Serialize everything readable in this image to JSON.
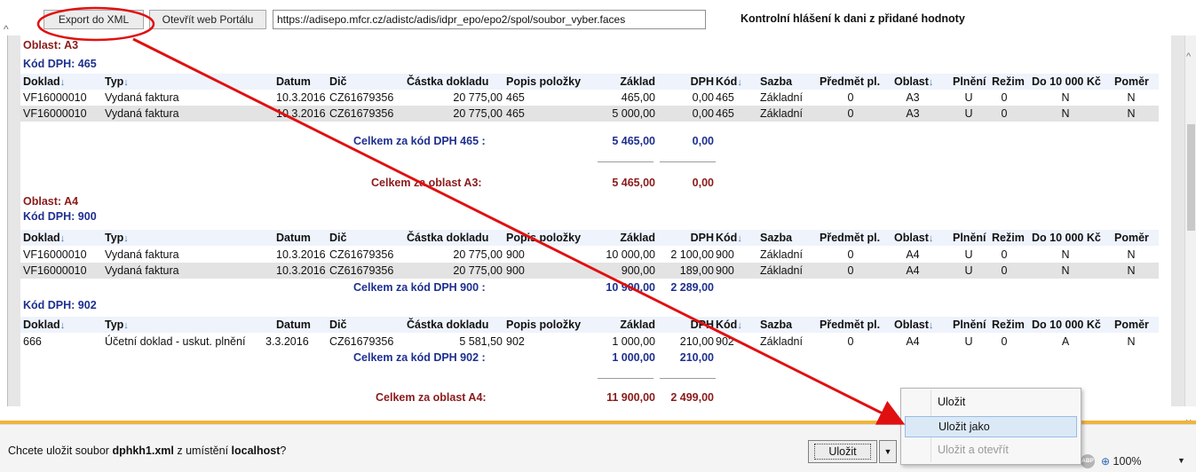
{
  "toolbar": {
    "export_label": "Export do XML",
    "portal_label": "Otevřít web Portálu",
    "url_value": "https://adisepo.mfcr.cz/adistc/adis/idpr_epo/epo2/spol/soubor_vyber.faces",
    "title": "Kontrolní hlášení k dani z přidané hodnoty"
  },
  "columns": {
    "doklad": "Doklad",
    "typ": "Typ",
    "datum": "Datum",
    "dic": "Dič",
    "castka": "Částka dokladu",
    "popis": "Popis položky",
    "zaklad": "Základ",
    "dph": "DPH",
    "kod": "Kód",
    "sazba": "Sazba",
    "predmet": "Předmět pl.",
    "oblast": "Oblast",
    "plneni": "Plnění",
    "rezim": "Režim",
    "do10000": "Do 10 000 Kč",
    "pomer": "Poměr"
  },
  "report": {
    "a3": {
      "title": "Oblast: A3",
      "code_title": "Kód DPH: 465",
      "rows": [
        {
          "doklad": "VF16000010",
          "typ": "Vydaná faktura",
          "datum": "10.3.2016",
          "dic": "CZ61679356",
          "castka": "20 775,00",
          "popis": "465",
          "zaklad": "465,00",
          "dph": "0,00",
          "kod": "465",
          "sazba": "Základní",
          "predmet": "0",
          "oblast": "A3",
          "plneni": "U",
          "rezim": "0",
          "do10000": "N",
          "pomer": "N"
        },
        {
          "doklad": "VF16000010",
          "typ": "Vydaná faktura",
          "datum": "10.3.2016",
          "dic": "CZ61679356",
          "castka": "20 775,00",
          "popis": "465",
          "zaklad": "5 000,00",
          "dph": "0,00",
          "kod": "465",
          "sazba": "Základní",
          "predmet": "0",
          "oblast": "A3",
          "plneni": "U",
          "rezim": "0",
          "do10000": "N",
          "pomer": "N"
        }
      ],
      "code_sum_label": "Celkem za kód DPH 465 :",
      "code_sum_zaklad": "5 465,00",
      "code_sum_dph": "0,00",
      "area_sum_label": "Celkem za oblast A3:",
      "area_sum_zaklad": "5 465,00",
      "area_sum_dph": "0,00"
    },
    "a4": {
      "title": "Oblast: A4",
      "code900_title": "Kód DPH: 900",
      "rows900": [
        {
          "doklad": "VF16000010",
          "typ": "Vydaná faktura",
          "datum": "10.3.2016",
          "dic": "CZ61679356",
          "castka": "20 775,00",
          "popis": "900",
          "zaklad": "10 000,00",
          "dph": "2 100,00",
          "kod": "900",
          "sazba": "Základní",
          "predmet": "0",
          "oblast": "A4",
          "plneni": "U",
          "rezim": "0",
          "do10000": "N",
          "pomer": "N"
        },
        {
          "doklad": "VF16000010",
          "typ": "Vydaná faktura",
          "datum": "10.3.2016",
          "dic": "CZ61679356",
          "castka": "20 775,00",
          "popis": "900",
          "zaklad": "900,00",
          "dph": "189,00",
          "kod": "900",
          "sazba": "Základní",
          "predmet": "0",
          "oblast": "A4",
          "plneni": "U",
          "rezim": "0",
          "do10000": "N",
          "pomer": "N"
        }
      ],
      "code900_sum_label": "Celkem za kód DPH 900 :",
      "code900_sum_zaklad": "10 900,00",
      "code900_sum_dph": "2 289,00",
      "code902_title": "Kód DPH: 902",
      "rows902": [
        {
          "doklad": "666",
          "typ": "Účetní doklad - uskut. plnění",
          "datum": "3.3.2016",
          "dic": "CZ61679356",
          "castka": "5 581,50",
          "popis": "902",
          "zaklad": "1 000,00",
          "dph": "210,00",
          "kod": "902",
          "sazba": "Základní",
          "predmet": "0",
          "oblast": "A4",
          "plneni": "U",
          "rezim": "0",
          "do10000": "A",
          "pomer": "N"
        }
      ],
      "code902_sum_label": "Celkem za kód DPH 902 :",
      "code902_sum_zaklad": "1 000,00",
      "code902_sum_dph": "210,00",
      "area_sum_label": "Celkem za oblast A4:",
      "area_sum_zaklad": "11 900,00",
      "area_sum_dph": "2 499,00"
    }
  },
  "notification": {
    "prefix": "Chcete uložit soubor ",
    "filename": "dphkh1.xml",
    "middle": " z umístění ",
    "location": "localhost",
    "suffix": "?",
    "save_label": "Uložit",
    "zoom": "100%",
    "abp_label": "ABP"
  },
  "menu": {
    "items": [
      "Uložit",
      "Uložit jako",
      "Uložit a otevřít"
    ]
  },
  "colors": {
    "area_title": "#8b1a1a",
    "code_title": "#1e2f8f",
    "annotation": "#e01010",
    "notify_stripe": "#f0b43c"
  }
}
